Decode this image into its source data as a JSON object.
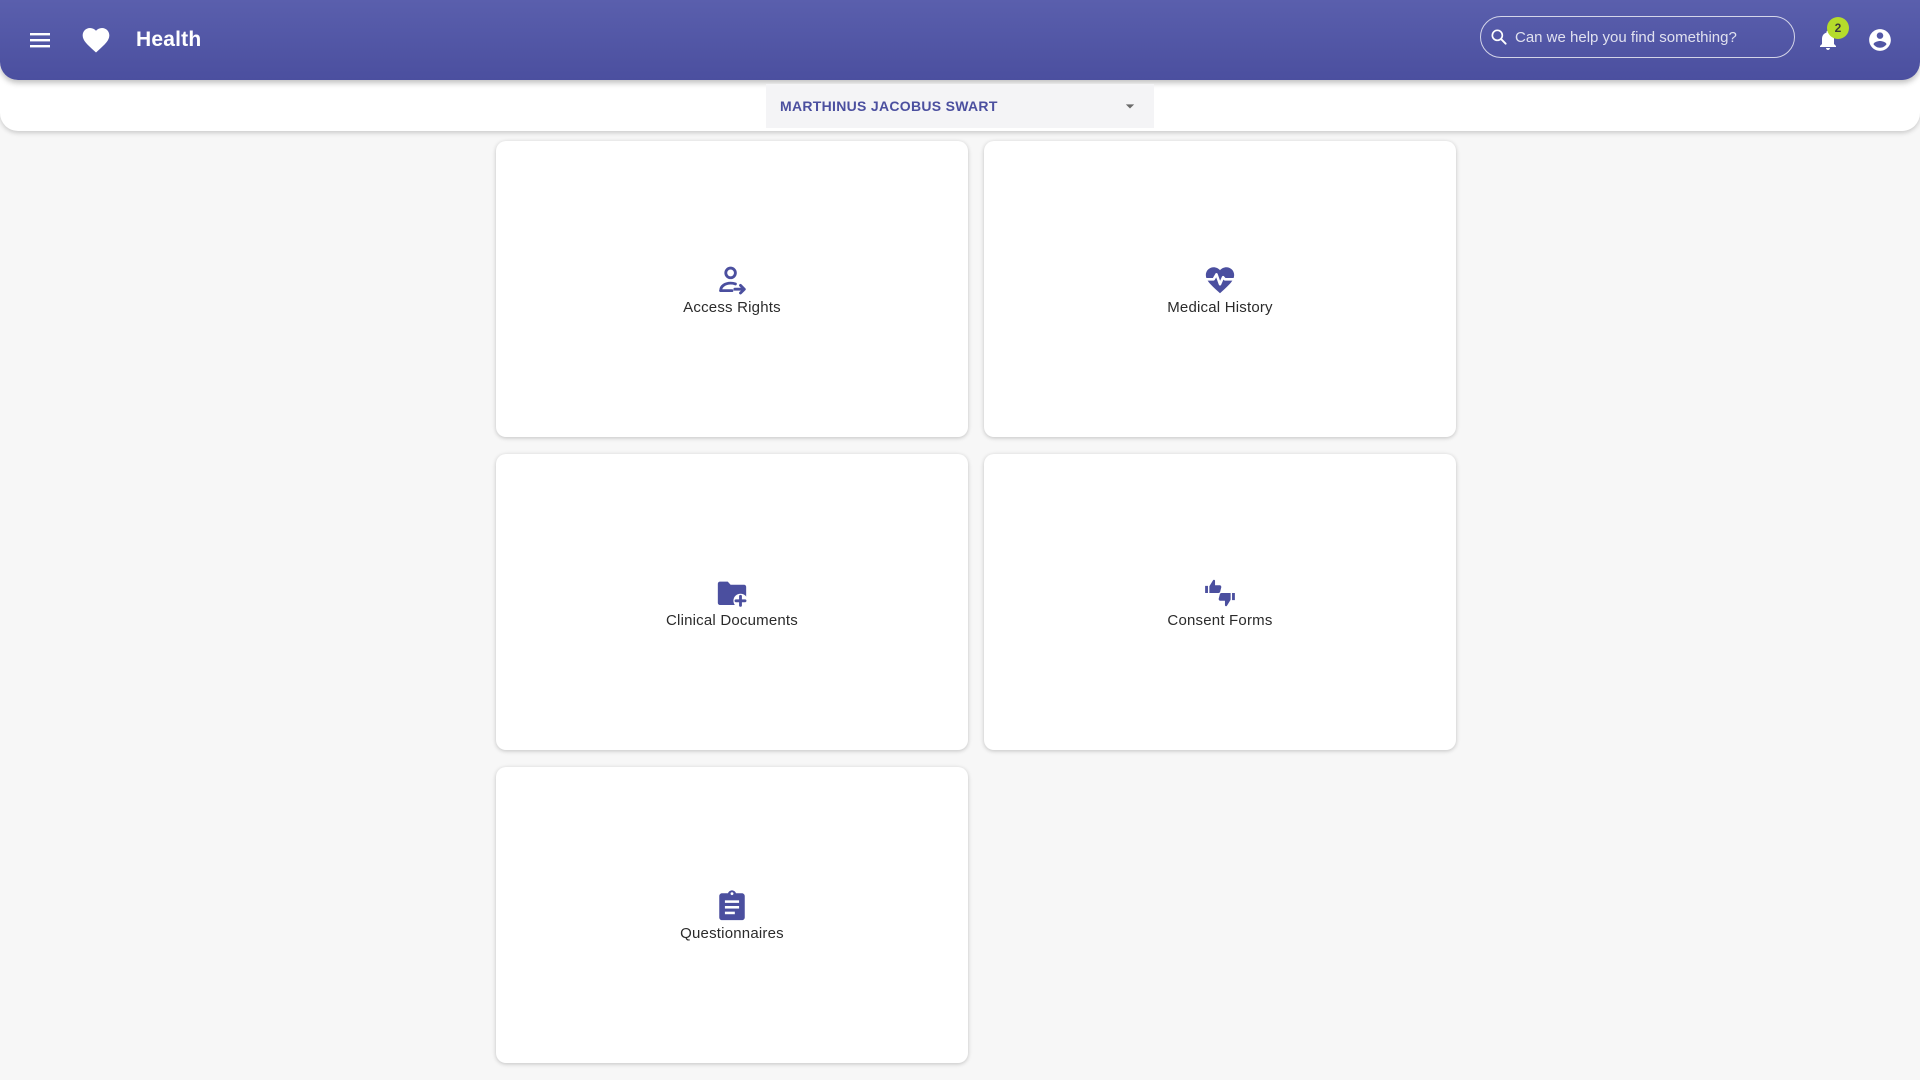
{
  "header": {
    "app_title": "Health",
    "search": {
      "placeholder": "Can we help you find something?",
      "value": ""
    },
    "notifications": {
      "count": "2"
    },
    "brand_color": "#4b4f9f",
    "badge_color": "#b5dc2b"
  },
  "patient_selector": {
    "selected": "MARTHINUS JACOBUS SWART"
  },
  "cards": [
    {
      "label": "Access Rights",
      "icon": "person-arrow-icon"
    },
    {
      "label": "Medical History",
      "icon": "heart-pulse-icon"
    },
    {
      "label": "Clinical Documents",
      "icon": "folder-plus-icon"
    },
    {
      "label": "Consent Forms",
      "icon": "thumbs-up-down-icon"
    },
    {
      "label": "Questionnaires",
      "icon": "clipboard-list-icon"
    }
  ]
}
